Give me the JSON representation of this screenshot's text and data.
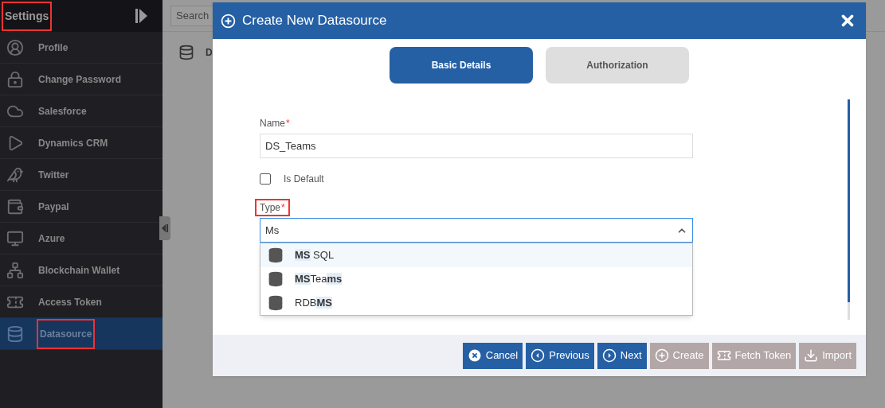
{
  "sidebar": {
    "title": "Settings",
    "title_highlighted": true,
    "items": [
      {
        "label": "Profile",
        "selected": false,
        "highlighted": false
      },
      {
        "label": "Change Password",
        "selected": false,
        "highlighted": false
      },
      {
        "label": "Salesforce",
        "selected": false,
        "highlighted": false
      },
      {
        "label": "Dynamics CRM",
        "selected": false,
        "highlighted": false
      },
      {
        "label": "Twitter",
        "selected": false,
        "highlighted": false
      },
      {
        "label": "Paypal",
        "selected": false,
        "highlighted": false
      },
      {
        "label": "Azure",
        "selected": false,
        "highlighted": false
      },
      {
        "label": "Blockchain Wallet",
        "selected": false,
        "highlighted": false
      },
      {
        "label": "Access Token",
        "selected": false,
        "highlighted": false
      },
      {
        "label": "Datasource",
        "selected": true,
        "highlighted": true
      }
    ]
  },
  "background": {
    "search": {
      "placeholder": "Search"
    },
    "card_label": "D"
  },
  "dialog": {
    "title": "Create New Datasource",
    "tabs": [
      {
        "label": "Basic Details",
        "selected": true
      },
      {
        "label": "Authorization",
        "selected": false
      }
    ],
    "name_field": {
      "label": "Name",
      "required_mark": "*",
      "value": "DS_Teams"
    },
    "is_default": {
      "label": "Is Default",
      "checked": false
    },
    "type_field": {
      "label": "Type",
      "required_mark": "*",
      "value": "Ms",
      "highlighted": true,
      "expanded": true,
      "options": [
        {
          "label": "**MS** SQL",
          "selected": true
        },
        {
          "label": "**MS**Tea**ms**",
          "selected": false
        },
        {
          "label": "RDB**MS**",
          "selected": false
        }
      ]
    },
    "buttons": [
      {
        "label": "Cancel",
        "disabled": false
      },
      {
        "label": "Previous",
        "disabled": false
      },
      {
        "label": "Next",
        "disabled": false
      },
      {
        "label": "Create",
        "disabled": true
      },
      {
        "label": "Fetch Token",
        "disabled": true
      },
      {
        "label": "Import",
        "disabled": true
      }
    ]
  }
}
